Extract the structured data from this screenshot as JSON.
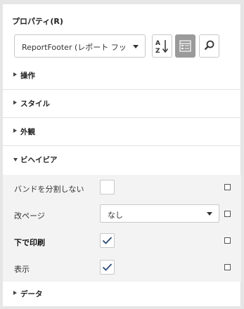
{
  "panel": {
    "title": "プロパティ(R)",
    "selector": {
      "value": "ReportFooter (レポート フッ..."
    },
    "toolbar": {
      "sort_icon": "sort-az-icon",
      "categorized_icon": "categorized-view-icon",
      "search_icon": "search-icon"
    },
    "sections": [
      {
        "label": "操作",
        "expanded": false
      },
      {
        "label": "スタイル",
        "expanded": false
      },
      {
        "label": "外観",
        "expanded": false
      },
      {
        "label": "ビヘイビア",
        "expanded": true
      },
      {
        "label": "データ",
        "expanded": false
      }
    ],
    "behavior_props": [
      {
        "name": "バンドを分割しない",
        "type": "checkbox",
        "checked": false
      },
      {
        "name": "改ページ",
        "type": "select",
        "value": "なし"
      },
      {
        "name": "下で印刷",
        "type": "checkbox",
        "checked": true,
        "bold": true
      },
      {
        "name": "表示",
        "type": "checkbox",
        "checked": true
      }
    ],
    "colors": {
      "active_button": "#9a9a9a",
      "check": "#2b4a73",
      "props_bg": "#f3f3f3"
    }
  }
}
